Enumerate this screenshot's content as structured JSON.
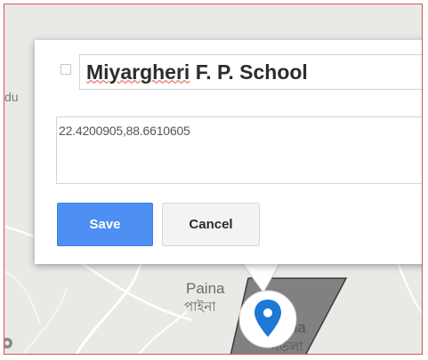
{
  "map": {
    "labels": {
      "du": "du",
      "paina": "Paina",
      "paina_bengali": "পাইনা",
      "ntala": "ntala",
      "ntala_bengali": "নতলা"
    },
    "colors": {
      "background": "#e9e9e6",
      "polygon_fill": "#6e6e6e",
      "marker": "#1f77d6"
    }
  },
  "dialog": {
    "title": "Miyargheri F. P. School",
    "title_misspelled": "Miyargheri",
    "title_rest": " F. P. School",
    "description": "22.4200905,88.6610605",
    "save_label": "Save",
    "cancel_label": "Cancel",
    "colors": {
      "save": "#4d8ff2",
      "cancel": "#f3f3f3"
    }
  },
  "icons": {
    "marker": "map-pin-icon",
    "collapse": "collapse-toggle-icon",
    "corner": "map-control-icon"
  }
}
